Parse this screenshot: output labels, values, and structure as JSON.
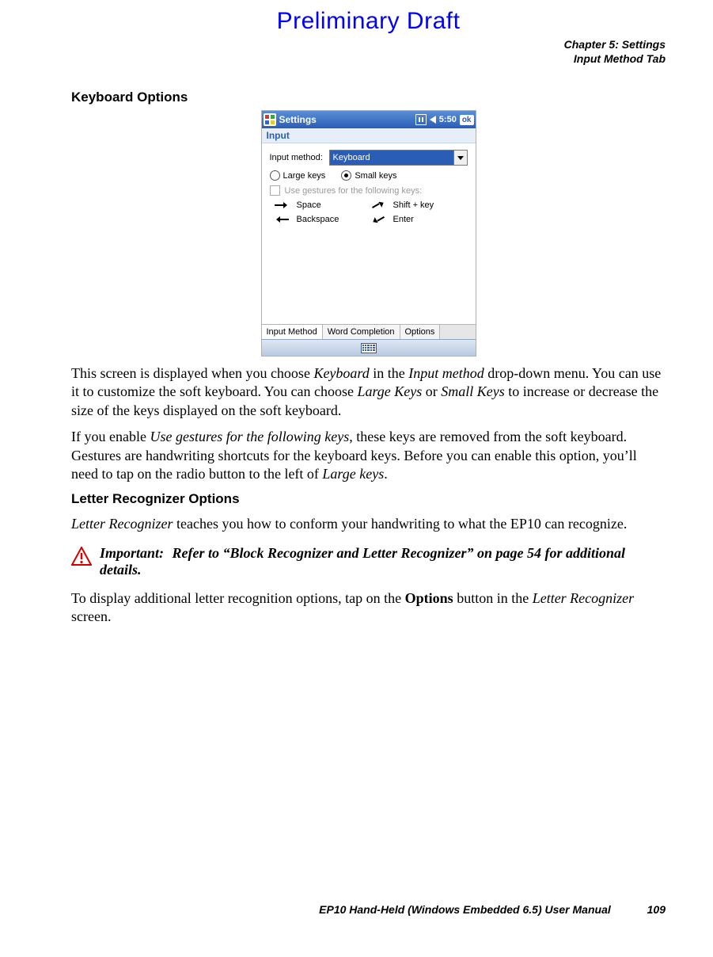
{
  "draft_title": "Preliminary Draft",
  "chapter_header": {
    "line1": "Chapter 5: Settings",
    "line2": "Input Method Tab"
  },
  "section1_heading": "Keyboard Options",
  "screenshot": {
    "titlebar": {
      "title": "Settings",
      "clock": "5:50",
      "ok": "ok"
    },
    "subheader": "Input",
    "input_method_label": "Input method:",
    "input_method_value": "Keyboard",
    "radio_large": "Large keys",
    "radio_small": "Small keys",
    "gestures_checkbox": "Use gestures for the following keys:",
    "gesture_space": "Space",
    "gesture_shift": "Shift + key",
    "gesture_backspace": "Backspace",
    "gesture_enter": "Enter",
    "tabs": {
      "t1": "Input Method",
      "t2": "Word Completion",
      "t3": "Options"
    }
  },
  "para1_before_kbd": "This screen is displayed when you choose ",
  "para1_kbd": "Keyboard",
  "para1_mid1": " in the ",
  "para1_im": "Input method",
  "para1_mid2": " drop-down menu. You can use it to customize the soft keyboard. You can choose ",
  "para1_lk": "Large Keys",
  "para1_or": " or ",
  "para1_sk": "Small Keys",
  "para1_end": " to increase or decrease the size of the keys displayed on the soft keyboard.",
  "para2_a": "If you enable ",
  "para2_ug": "Use gestures for the following keys",
  "para2_b": ", these keys are removed from the soft keyboard. Gestures are handwriting shortcuts for the keyboard keys. Before you can enable this option, you’ll need to tap on the radio button to the left of ",
  "para2_lk": "Large keys",
  "para2_c": ".",
  "section2_heading": "Letter Recognizer Options",
  "para3_a": "Letter Recognizer",
  "para3_b": " teaches you how to conform your handwriting to what the EP10 can recognize.",
  "important_label": "Important:",
  "important_text": "Refer to “Block Recognizer and Letter Recognizer” on page 54 for additional details.",
  "para4_a": "To display additional letter recognition options, tap on the ",
  "para4_b": "Options",
  "para4_c": " button in the ",
  "para4_d": "Letter Recognizer",
  "para4_e": " screen.",
  "footer_text": "EP10 Hand-Held (Windows Embedded 6.5) User Manual",
  "footer_page": "109"
}
